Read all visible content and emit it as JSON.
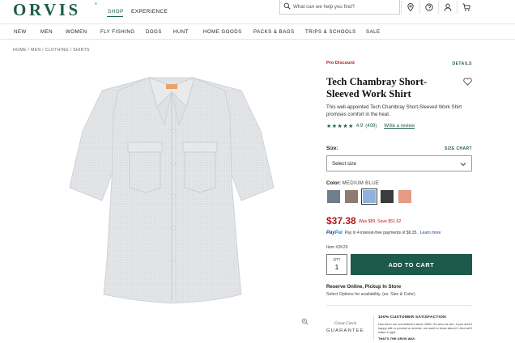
{
  "header": {
    "logo": "ORVIS",
    "logo_mark": "®",
    "tabs": [
      {
        "label": "SHOP",
        "active": true
      },
      {
        "label": "EXPERIENCE",
        "active": false
      }
    ],
    "search_placeholder": "What can we help you find?",
    "icons": [
      "location-icon",
      "help-icon",
      "account-icon",
      "cart-icon"
    ]
  },
  "nav": {
    "categories": [
      "NEW",
      "MEN",
      "WOMEN",
      "FLY FISHING",
      "DOGS",
      "HUNT",
      "HOME GOODS",
      "PACKS & BAGS",
      "TRIPS & SCHOOLS",
      "SALE"
    ]
  },
  "breadcrumb": "HOME / MEN / CLOTHING / SHIRTS",
  "product": {
    "promo": "Pro Discount",
    "details_link": "DETAILS",
    "title": "Tech Chambray Short-Sleeved Work Shirt",
    "description": "This well-appointed Tech Chambray Short-Sleeved Work Shirt promises comfort in the heat.",
    "rating": {
      "stars": "★★★★★",
      "value": "4.9",
      "count": "(409)",
      "write_review": "Write a review"
    },
    "size": {
      "label": "Size:",
      "chart_link": "SIZE CHART",
      "selected": "Select size"
    },
    "color": {
      "label": "Color:",
      "selected": "MEDIUM BLUE",
      "swatches": [
        {
          "name": "slate",
          "hex": "#6f7d8c"
        },
        {
          "name": "taupe",
          "hex": "#8c7c72"
        },
        {
          "name": "medium-blue",
          "hex": "#8fb2dc",
          "selected": true
        },
        {
          "name": "charcoal",
          "hex": "#3b3c3e"
        },
        {
          "name": "coral",
          "hex": "#e69a84"
        }
      ]
    },
    "price": "$37.38",
    "was_price": "Was $89, Save $51.62",
    "paypal": {
      "logo_pay": "Pay",
      "logo_pal": "Pal",
      "text": "Pay in 4 interest-free payments of $9.35.",
      "learn_more": "Learn more"
    },
    "item_number": "Item #2K29",
    "quantity": {
      "label": "QTY",
      "value": "1"
    },
    "add_to_cart": "ADD TO CART",
    "reserve_title": "Reserve Online, Pickup In Store",
    "reserve_sub": "Select Options for availability. (ex. Size & Color)"
  },
  "guarantee": {
    "logo_script": "Great Catch",
    "logo_word": "GUARANTEE",
    "heading": "100% CUSTOMER SATISFACTION",
    "text": "Has been our commitment since 1856. It's who we are. If you aren't happy with a product or service, we want to know about it. And we'll make it right.",
    "tail": "THAT'S THE ORVIS WAY."
  },
  "colors": {
    "brand": "#1f5c4c",
    "sale": "#b8171c",
    "cart_button": "#1d5a4b",
    "shirt": "#e3e5e7"
  }
}
